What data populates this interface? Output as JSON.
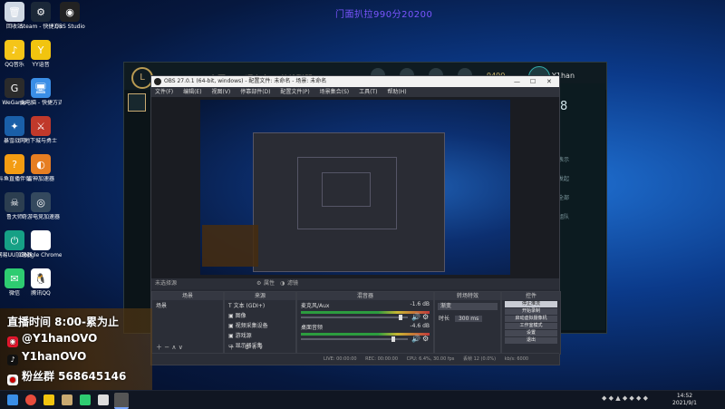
{
  "banner": "门面扒拉990分20200",
  "desktop_icons": [
    {
      "label": "回收站",
      "icon": "recycle-bin-icon",
      "color": "#cfd8e3",
      "glyph": "🗑"
    },
    {
      "label": "Steam - 快捷方式",
      "icon": "steam-icon",
      "color": "#1b2838",
      "glyph": "⚙"
    },
    {
      "label": "OBS Studio",
      "icon": "obs-icon",
      "color": "#222222",
      "glyph": "◉"
    },
    {
      "label": "QQ音乐",
      "icon": "qq-music-icon",
      "color": "#f5c518",
      "glyph": "♪"
    },
    {
      "label": "YY语音",
      "icon": "yy-icon",
      "color": "#f1c40f",
      "glyph": "Y"
    },
    {
      "label": "WeGame",
      "icon": "wegame-icon",
      "color": "#2b2b2b",
      "glyph": "G"
    },
    {
      "label": "此电脑 - 快捷方式",
      "icon": "computer-icon",
      "color": "#3a8ee6",
      "glyph": "🖥"
    },
    {
      "label": "暴雪战网",
      "icon": "battlenet-icon",
      "color": "#1a5fa8",
      "glyph": "✦"
    },
    {
      "label": "地下城与勇士",
      "icon": "dnf-icon",
      "color": "#c0392b",
      "glyph": "⚔"
    },
    {
      "label": "斗鱼直播伴侣",
      "icon": "douyu-icon",
      "color": "#f39c12",
      "glyph": "?"
    },
    {
      "label": "雷神加速器",
      "icon": "leishen-icon",
      "color": "#e67e22",
      "glyph": "◐"
    },
    {
      "label": "鲁大师",
      "icon": "ludashi-icon",
      "color": "#2c3e50",
      "glyph": "☠"
    },
    {
      "label": "奇游电竞加速器",
      "icon": "qiyou-icon",
      "color": "#34495e",
      "glyph": "◎"
    },
    {
      "label": "网易UU加速器",
      "icon": "uu-icon",
      "color": "#16a085",
      "glyph": "⏻"
    },
    {
      "label": "Google Chrome",
      "icon": "chrome-icon",
      "color": "#ffffff",
      "glyph": "◍"
    },
    {
      "label": "微信",
      "icon": "wechat-icon",
      "color": "#2ecc71",
      "glyph": "✉"
    },
    {
      "label": "腾讯QQ",
      "icon": "qq-icon",
      "color": "#ffffff",
      "glyph": "🐧"
    }
  ],
  "game_client": {
    "nav_items": [
      "主页",
      "云顶之弈",
      "英雄联盟"
    ],
    "currency": "9490",
    "player_name": "Y1han",
    "side_items": [
      "8",
      "表示",
      "发起",
      "全部",
      "组队"
    ]
  },
  "obs": {
    "title": "OBS 27.0.1 (64-bit, windows) - 配置文件: 未命名 - 场景: 未命名",
    "menu": [
      "文件(F)",
      "编辑(E)",
      "视图(V)",
      "停靠部件(D)",
      "配置文件(P)",
      "场景集合(S)",
      "工具(T)",
      "帮助(H)"
    ],
    "scene_bar_label": "未选择源",
    "scene_bar_props": "属性",
    "scene_bar_filters": "滤镜",
    "panels": {
      "scenes": {
        "header": "场景",
        "items": [
          "场景"
        ]
      },
      "sources": {
        "header": "来源",
        "items": [
          "文本 (GDI+)",
          "图像",
          "视频采集设备",
          "游戏源",
          "显示器采集"
        ]
      },
      "mixer": {
        "header": "混音器",
        "tracks": [
          {
            "name": "麦克风/Aux",
            "db": "-1.6 dB"
          },
          {
            "name": "桌面音频",
            "db": "-4.6 dB"
          }
        ]
      },
      "transitions": {
        "header": "转场特效",
        "type": "渐变",
        "duration_label": "时长",
        "duration": "300 ms"
      },
      "controls": {
        "header": "控件",
        "buttons": [
          "停止推流",
          "开始录制",
          "启动虚拟摄像机",
          "工作室模式",
          "设置",
          "退出"
        ]
      }
    },
    "status": {
      "live": "LIVE: 00:00:00",
      "rec": "REC: 00:00:00",
      "cpu": "CPU: 6.4%, 30.00 fps",
      "dropped": "丢帧 12 (0.0%)",
      "bitrate": "kb/s: 6000"
    }
  },
  "overlay": {
    "schedule": "直播时间 8:00-累为止",
    "weibo": "@Y1hanOVO",
    "douyin": "Y1hanOVO",
    "fans": "粉丝群 568645146"
  },
  "taskbar": {
    "time": "14:52",
    "date": "2021/9/1"
  }
}
